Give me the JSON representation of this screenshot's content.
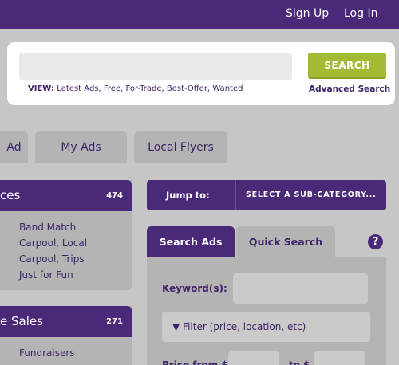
{
  "header": {
    "signup_label": "Sign Up",
    "login_label": "Log In"
  },
  "search": {
    "query": "",
    "placeholder": "",
    "button_label": "SEARCH",
    "view_label": "VIEW:",
    "view_links": [
      "Latest Ads",
      "Free",
      "For-Trade",
      "Best-Offer",
      "Wanted"
    ],
    "advanced_label": "Advanced Search"
  },
  "tabs": [
    "Ad",
    "My Ads",
    "Local Flyers"
  ],
  "categories": [
    {
      "title": "ces",
      "count": "474",
      "items": [
        "Band Match",
        "Carpool, Local",
        "Carpool, Trips",
        "Just for Fun"
      ]
    },
    {
      "title": "e Sales",
      "count": "271",
      "items": [
        "Fundraisers"
      ]
    }
  ],
  "jump": {
    "label": "Jump to:",
    "select_label": "SELECT A SUB-CATEGORY..."
  },
  "search_tabs": [
    "Search Ads",
    "Quick Search"
  ],
  "help_icon": "question-circle-icon",
  "form": {
    "keyword_label": "Keyword(s):",
    "filter_label": "▼ Filter (price, location, etc)",
    "price_from_label": "Price from $",
    "price_to_label": "to $"
  },
  "colors": {
    "brand_purple": "#4a2a78",
    "accent_green": "#a2bb34",
    "background": "#c6c6c6",
    "panel": "#b4b4b4"
  }
}
